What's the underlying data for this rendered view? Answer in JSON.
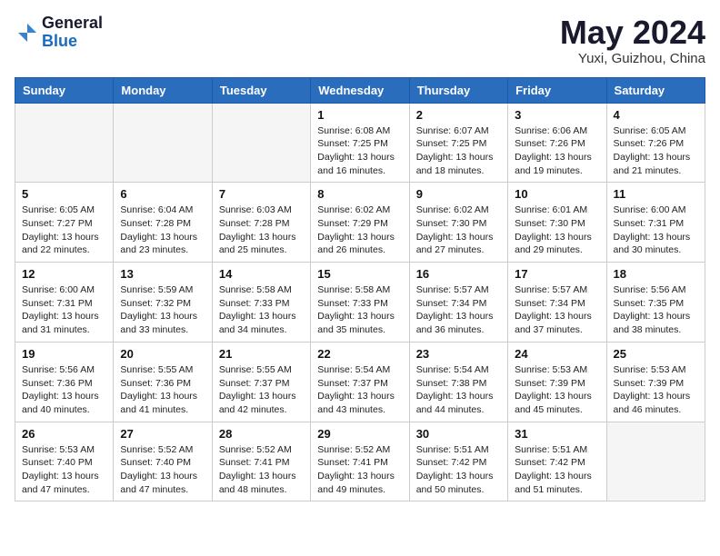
{
  "header": {
    "logo_general": "General",
    "logo_blue": "Blue",
    "month_title": "May 2024",
    "location": "Yuxi, Guizhou, China"
  },
  "weekdays": [
    "Sunday",
    "Monday",
    "Tuesday",
    "Wednesday",
    "Thursday",
    "Friday",
    "Saturday"
  ],
  "weeks": [
    [
      {
        "day": "",
        "info": ""
      },
      {
        "day": "",
        "info": ""
      },
      {
        "day": "",
        "info": ""
      },
      {
        "day": "1",
        "info": "Sunrise: 6:08 AM\nSunset: 7:25 PM\nDaylight: 13 hours and 16 minutes."
      },
      {
        "day": "2",
        "info": "Sunrise: 6:07 AM\nSunset: 7:25 PM\nDaylight: 13 hours and 18 minutes."
      },
      {
        "day": "3",
        "info": "Sunrise: 6:06 AM\nSunset: 7:26 PM\nDaylight: 13 hours and 19 minutes."
      },
      {
        "day": "4",
        "info": "Sunrise: 6:05 AM\nSunset: 7:26 PM\nDaylight: 13 hours and 21 minutes."
      }
    ],
    [
      {
        "day": "5",
        "info": "Sunrise: 6:05 AM\nSunset: 7:27 PM\nDaylight: 13 hours and 22 minutes."
      },
      {
        "day": "6",
        "info": "Sunrise: 6:04 AM\nSunset: 7:28 PM\nDaylight: 13 hours and 23 minutes."
      },
      {
        "day": "7",
        "info": "Sunrise: 6:03 AM\nSunset: 7:28 PM\nDaylight: 13 hours and 25 minutes."
      },
      {
        "day": "8",
        "info": "Sunrise: 6:02 AM\nSunset: 7:29 PM\nDaylight: 13 hours and 26 minutes."
      },
      {
        "day": "9",
        "info": "Sunrise: 6:02 AM\nSunset: 7:30 PM\nDaylight: 13 hours and 27 minutes."
      },
      {
        "day": "10",
        "info": "Sunrise: 6:01 AM\nSunset: 7:30 PM\nDaylight: 13 hours and 29 minutes."
      },
      {
        "day": "11",
        "info": "Sunrise: 6:00 AM\nSunset: 7:31 PM\nDaylight: 13 hours and 30 minutes."
      }
    ],
    [
      {
        "day": "12",
        "info": "Sunrise: 6:00 AM\nSunset: 7:31 PM\nDaylight: 13 hours and 31 minutes."
      },
      {
        "day": "13",
        "info": "Sunrise: 5:59 AM\nSunset: 7:32 PM\nDaylight: 13 hours and 33 minutes."
      },
      {
        "day": "14",
        "info": "Sunrise: 5:58 AM\nSunset: 7:33 PM\nDaylight: 13 hours and 34 minutes."
      },
      {
        "day": "15",
        "info": "Sunrise: 5:58 AM\nSunset: 7:33 PM\nDaylight: 13 hours and 35 minutes."
      },
      {
        "day": "16",
        "info": "Sunrise: 5:57 AM\nSunset: 7:34 PM\nDaylight: 13 hours and 36 minutes."
      },
      {
        "day": "17",
        "info": "Sunrise: 5:57 AM\nSunset: 7:34 PM\nDaylight: 13 hours and 37 minutes."
      },
      {
        "day": "18",
        "info": "Sunrise: 5:56 AM\nSunset: 7:35 PM\nDaylight: 13 hours and 38 minutes."
      }
    ],
    [
      {
        "day": "19",
        "info": "Sunrise: 5:56 AM\nSunset: 7:36 PM\nDaylight: 13 hours and 40 minutes."
      },
      {
        "day": "20",
        "info": "Sunrise: 5:55 AM\nSunset: 7:36 PM\nDaylight: 13 hours and 41 minutes."
      },
      {
        "day": "21",
        "info": "Sunrise: 5:55 AM\nSunset: 7:37 PM\nDaylight: 13 hours and 42 minutes."
      },
      {
        "day": "22",
        "info": "Sunrise: 5:54 AM\nSunset: 7:37 PM\nDaylight: 13 hours and 43 minutes."
      },
      {
        "day": "23",
        "info": "Sunrise: 5:54 AM\nSunset: 7:38 PM\nDaylight: 13 hours and 44 minutes."
      },
      {
        "day": "24",
        "info": "Sunrise: 5:53 AM\nSunset: 7:39 PM\nDaylight: 13 hours and 45 minutes."
      },
      {
        "day": "25",
        "info": "Sunrise: 5:53 AM\nSunset: 7:39 PM\nDaylight: 13 hours and 46 minutes."
      }
    ],
    [
      {
        "day": "26",
        "info": "Sunrise: 5:53 AM\nSunset: 7:40 PM\nDaylight: 13 hours and 47 minutes."
      },
      {
        "day": "27",
        "info": "Sunrise: 5:52 AM\nSunset: 7:40 PM\nDaylight: 13 hours and 47 minutes."
      },
      {
        "day": "28",
        "info": "Sunrise: 5:52 AM\nSunset: 7:41 PM\nDaylight: 13 hours and 48 minutes."
      },
      {
        "day": "29",
        "info": "Sunrise: 5:52 AM\nSunset: 7:41 PM\nDaylight: 13 hours and 49 minutes."
      },
      {
        "day": "30",
        "info": "Sunrise: 5:51 AM\nSunset: 7:42 PM\nDaylight: 13 hours and 50 minutes."
      },
      {
        "day": "31",
        "info": "Sunrise: 5:51 AM\nSunset: 7:42 PM\nDaylight: 13 hours and 51 minutes."
      },
      {
        "day": "",
        "info": ""
      }
    ]
  ]
}
